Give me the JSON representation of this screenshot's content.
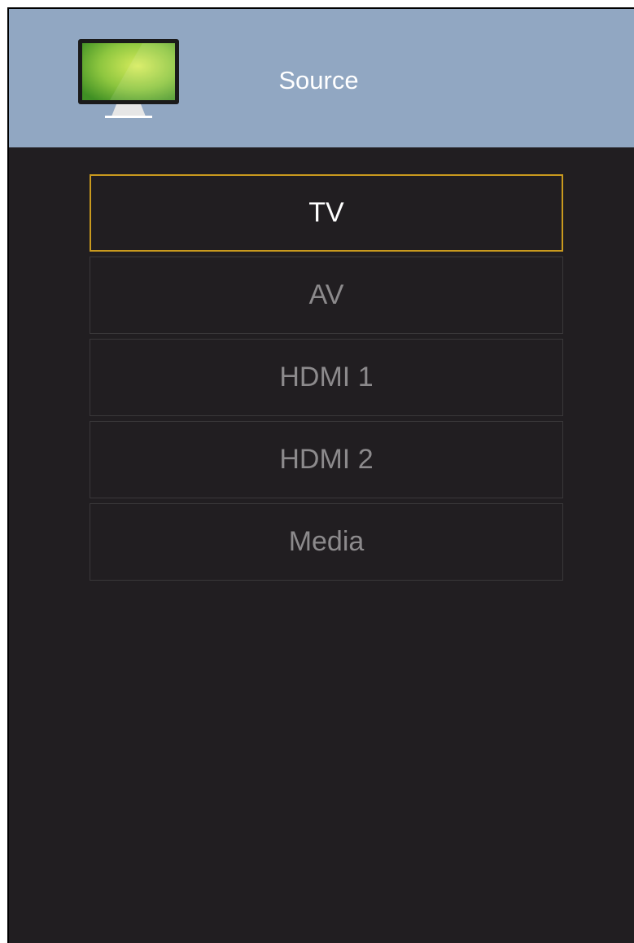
{
  "header": {
    "title": "Source",
    "icon": "tv-monitor-icon"
  },
  "menu": {
    "items": [
      {
        "label": "TV",
        "selected": true
      },
      {
        "label": "AV",
        "selected": false
      },
      {
        "label": "HDMI 1",
        "selected": false
      },
      {
        "label": "HDMI 2",
        "selected": false
      },
      {
        "label": "Media",
        "selected": false
      }
    ]
  },
  "colors": {
    "header_bg": "#91a7c2",
    "panel_bg": "#211e21",
    "selected_border": "#c99a1e",
    "item_text": "#8c8a8c",
    "selected_text": "#ffffff"
  }
}
